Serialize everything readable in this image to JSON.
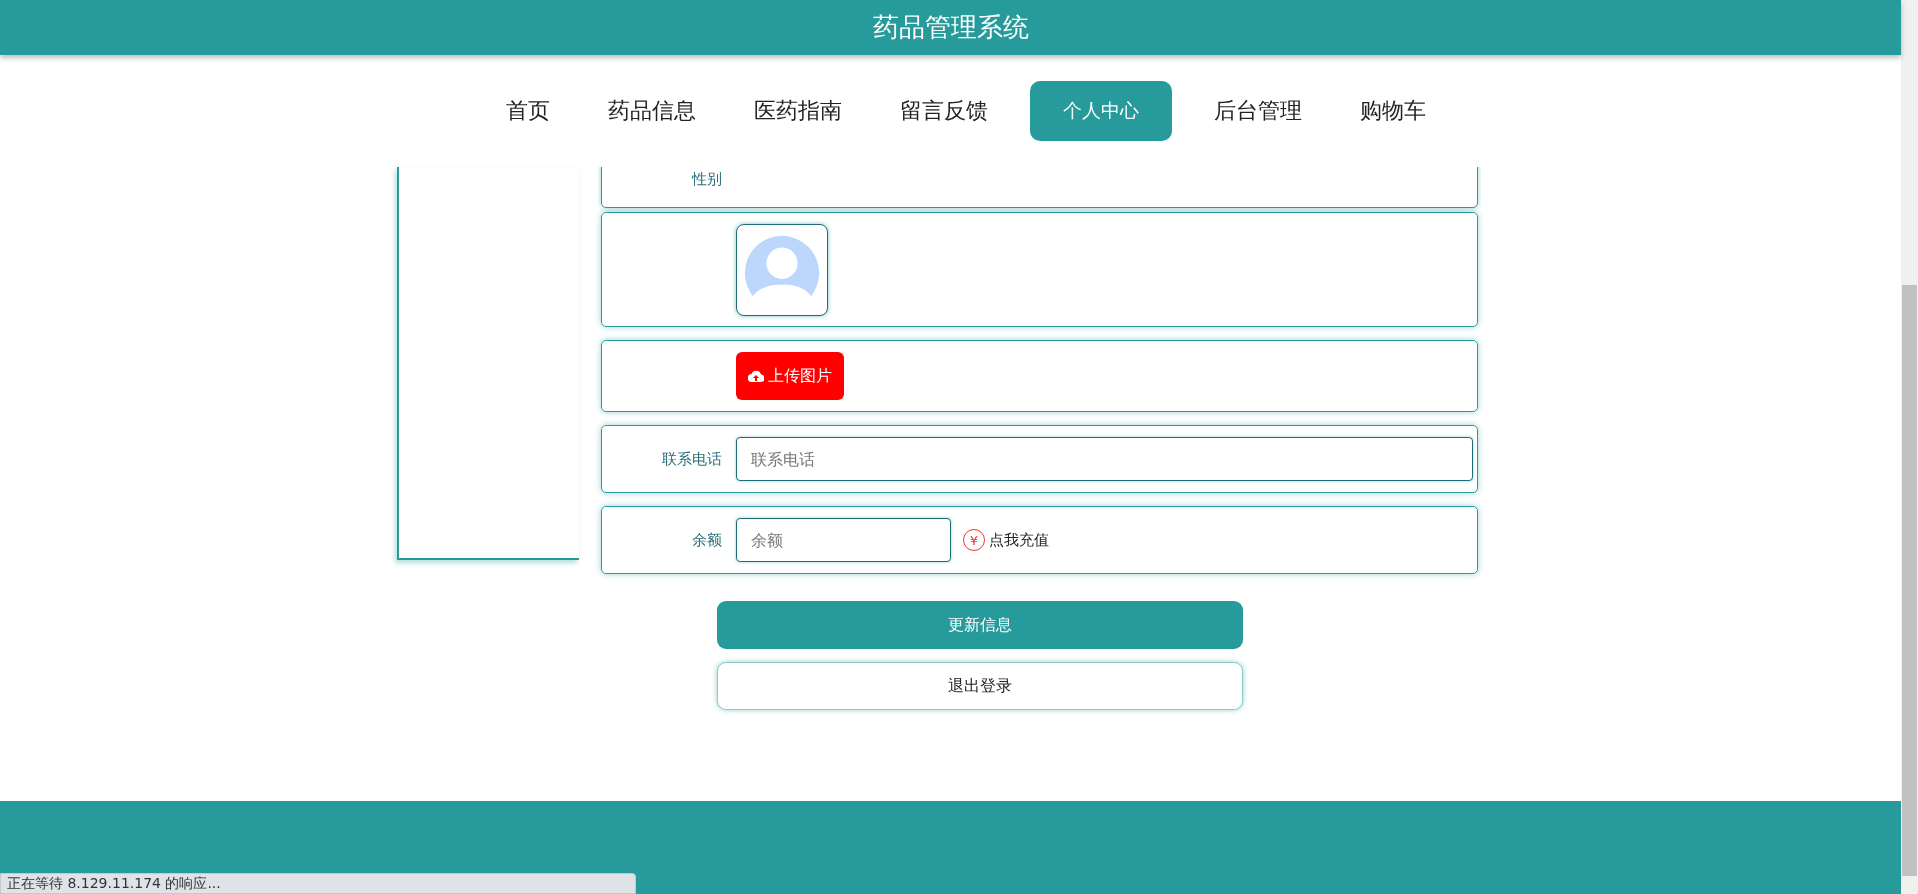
{
  "header": {
    "title": "药品管理系统"
  },
  "nav": [
    {
      "label": "首页",
      "selected": false
    },
    {
      "label": "药品信息",
      "selected": false
    },
    {
      "label": "医药指南",
      "selected": false
    },
    {
      "label": "留言反馈",
      "selected": false
    },
    {
      "label": "个人中心",
      "selected": true
    },
    {
      "label": "后台管理",
      "selected": false
    },
    {
      "label": "购物车",
      "selected": false
    }
  ],
  "form": {
    "gender_label": "性别",
    "upload_button": "上传图片",
    "phone": {
      "label": "联系电话",
      "placeholder": "联系电话"
    },
    "balance": {
      "label": "余额",
      "placeholder": "余额",
      "recharge_icon": "¥",
      "recharge_link": "点我充值"
    }
  },
  "buttons": {
    "update": "更新信息",
    "logout": "退出登录"
  },
  "status_bar": "正在等待 8.129.11.174 的响应..."
}
